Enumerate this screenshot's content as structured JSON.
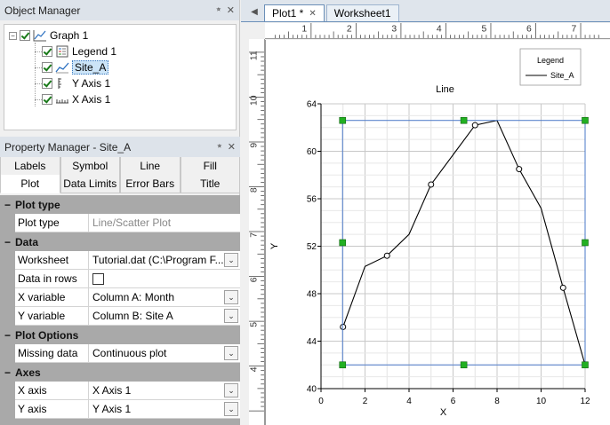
{
  "object_manager": {
    "title": "Object Manager",
    "pin": "⭒",
    "close": "✕",
    "tree": [
      {
        "label": "Graph 1",
        "selected": false
      },
      {
        "label": "Legend 1",
        "selected": false
      },
      {
        "label": "Site_A",
        "selected": true
      },
      {
        "label": "Y Axis 1",
        "selected": false
      },
      {
        "label": "X Axis 1",
        "selected": false
      }
    ]
  },
  "property_manager": {
    "title": "Property Manager - Site_A",
    "tabs_row1": [
      "Labels",
      "Symbol",
      "Line",
      "Fill"
    ],
    "tabs_row2": [
      "Plot",
      "Data Limits",
      "Error Bars",
      "Title"
    ],
    "categories": [
      {
        "name": "Plot type",
        "rows": [
          {
            "key": "Plot type",
            "value": "Line/Scatter Plot",
            "gray": true
          }
        ]
      },
      {
        "name": "Data",
        "rows": [
          {
            "key": "Worksheet",
            "value": "Tutorial.dat (C:\\Program F...",
            "dropdown": true
          },
          {
            "key": "Data in rows",
            "value": "",
            "checkbox": true
          },
          {
            "key": "X variable",
            "value": "Column A: Month",
            "dropdown": true
          },
          {
            "key": "Y variable",
            "value": "Column B: Site A",
            "dropdown": true
          }
        ]
      },
      {
        "name": "Plot Options",
        "rows": [
          {
            "key": "Missing data",
            "value": "Continuous plot",
            "dropdown": true
          }
        ]
      },
      {
        "name": "Axes",
        "rows": [
          {
            "key": "X axis",
            "value": "X Axis 1",
            "dropdown": true
          },
          {
            "key": "Y axis",
            "value": "Y Axis 1",
            "dropdown": true
          }
        ]
      }
    ]
  },
  "documents": {
    "tabs": [
      {
        "label": "Plot1 *",
        "active": true,
        "closable": true
      },
      {
        "label": "Worksheet1",
        "active": false,
        "closable": false
      }
    ]
  },
  "ruler": {
    "top_labels": [
      "1",
      "2",
      "3",
      "4",
      "5",
      "6",
      "7"
    ],
    "left_labels": [
      "11",
      "10",
      "9",
      "8",
      "7",
      "6",
      "5",
      "4"
    ]
  },
  "legend": {
    "title": "Legend",
    "entry": "Site_A"
  },
  "chart_data": {
    "type": "line",
    "title": "Line",
    "xlabel": "X",
    "ylabel": "Y",
    "xlim": [
      0,
      12
    ],
    "ylim": [
      40,
      64
    ],
    "xticks": [
      "0",
      "2",
      "4",
      "6",
      "8",
      "10",
      "12"
    ],
    "yticks": [
      "40",
      "44",
      "48",
      "52",
      "56",
      "60",
      "64"
    ],
    "grid": true,
    "legend_position": "top-right",
    "series": [
      {
        "name": "Site_A",
        "x": [
          1,
          2,
          3,
          4,
          5,
          6,
          7,
          8,
          9,
          10,
          11,
          12
        ],
        "y": [
          45.2,
          50.3,
          51.2,
          53.0,
          57.2,
          59.7,
          62.2,
          62.6,
          58.5,
          55.2,
          48.5,
          42.0
        ],
        "markers": true
      }
    ],
    "color": "#000000"
  }
}
